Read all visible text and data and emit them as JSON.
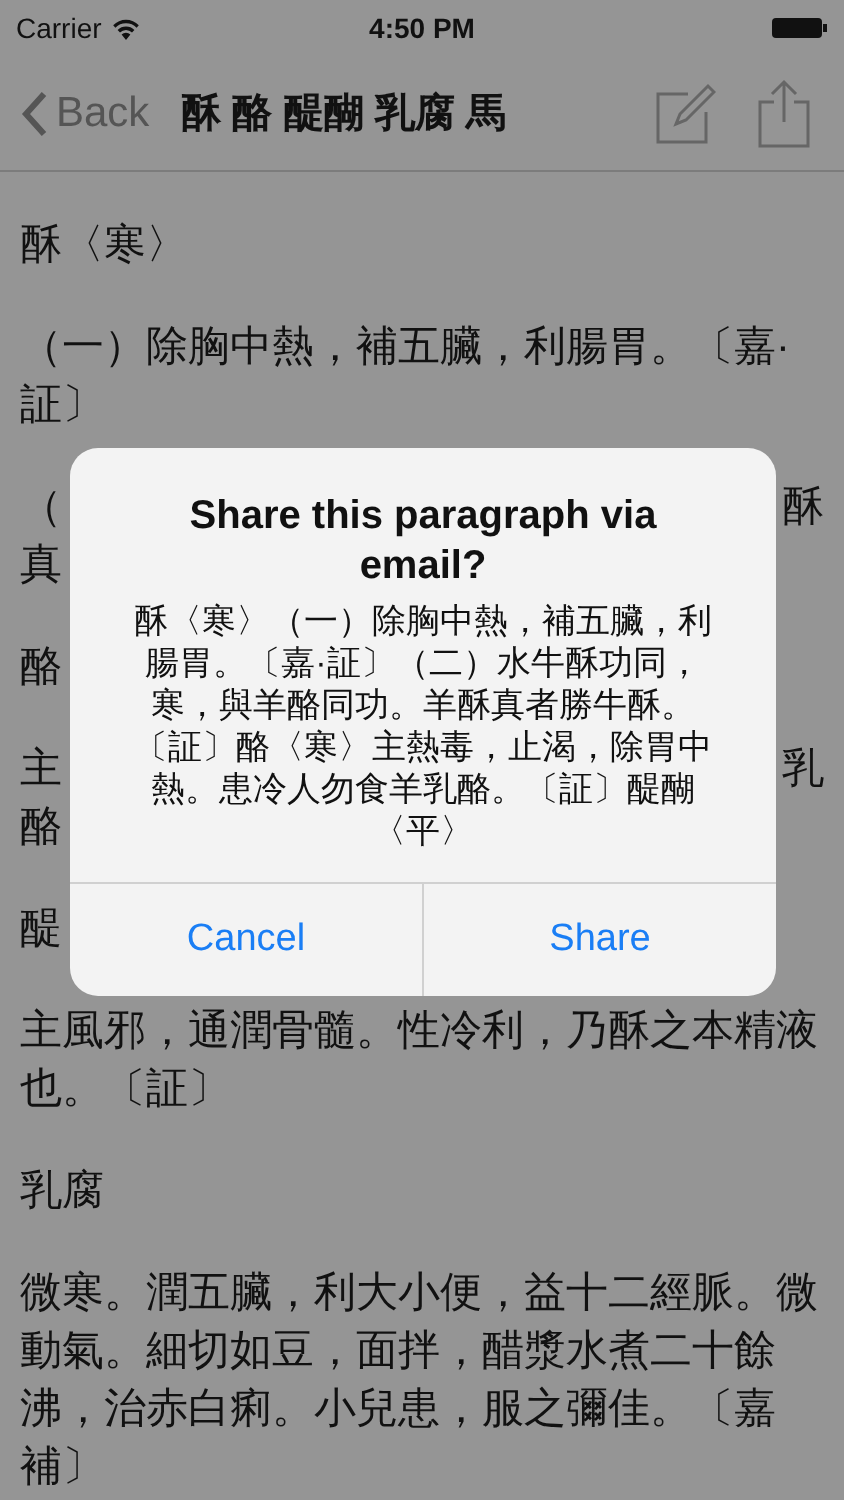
{
  "status_bar": {
    "carrier": "Carrier",
    "time": "4:50 PM"
  },
  "nav": {
    "back": "Back",
    "title": "酥 酪 醍醐 乳腐 馬"
  },
  "paragraphs": [
    {
      "kind": "full",
      "text": "酥〈寒〉"
    },
    {
      "kind": "full",
      "text": "（一）除胸中熱，補五臟，利腸胃。〔嘉·証〕"
    },
    {
      "kind": "covered",
      "lines": [
        {
          "left": "（",
          "right": "酥"
        },
        {
          "left": "真"
        }
      ]
    },
    {
      "kind": "covered",
      "lines": [
        {
          "left": "酪"
        }
      ]
    },
    {
      "kind": "covered",
      "lines": [
        {
          "left": "主",
          "right": "乳"
        },
        {
          "left": "酪"
        }
      ]
    },
    {
      "kind": "covered",
      "lines": [
        {
          "left": "醍"
        }
      ]
    },
    {
      "kind": "full",
      "text": "主風邪，通潤骨髓。性冷利，乃酥之本精液也。〔証〕"
    },
    {
      "kind": "full",
      "text": "乳腐"
    },
    {
      "kind": "full",
      "text": "微寒。潤五臟，利大小便，益十二經脈。微動氣。細切如豆，面拌，醋漿水煮二十餘沸，治赤白痢。小兒患，服之彌佳。〔嘉補〕"
    }
  ],
  "alert": {
    "title": "Share this paragraph via email?",
    "message": "酥〈寒〉（一）除胸中熱，補五臟，利腸胃。〔嘉·証〕（二）水牛酥功同，寒，與羊酪同功。羊酥真者勝牛酥。〔証〕酪〈寒〉主熱毒，止渴，除胃中熱。患冷人勿食羊乳酪。〔証〕醍醐〈平〉",
    "buttons": [
      "Cancel",
      "Share"
    ]
  }
}
